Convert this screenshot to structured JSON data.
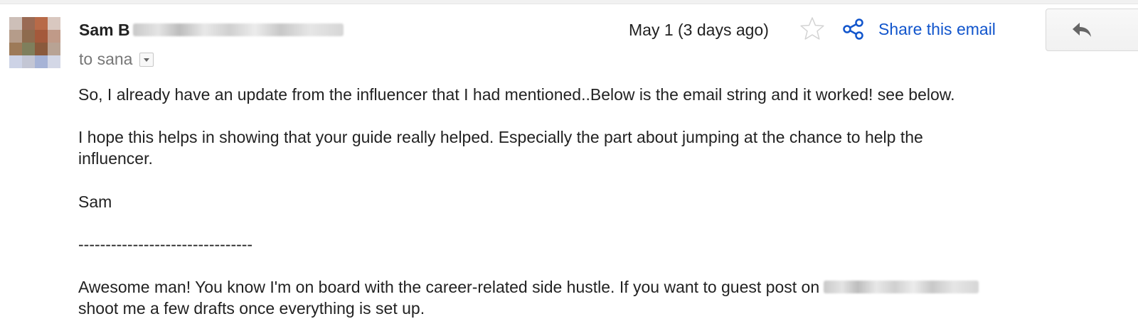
{
  "sender": {
    "name_visible": "Sam B",
    "recipient_line": "to sana"
  },
  "meta": {
    "date": "May 1 (3 days ago)"
  },
  "actions": {
    "share_label": "Share this email"
  },
  "icons": {
    "star": "star-outline-icon",
    "share": "share-icon",
    "reply": "reply-arrow-icon",
    "details": "chevron-down-icon"
  },
  "colors": {
    "link": "#1155cc",
    "text": "#222222",
    "muted": "#777777"
  },
  "body": {
    "p1": "So, I already have an update from the influencer that I had mentioned..Below is the email string and it worked! see below.",
    "p2_line1": "I hope this helps in showing that your guide really helped. Especially the part about jumping at the chance to help the",
    "p2_line2": "influencer.",
    "signoff": "Sam",
    "separator": "--------------------------------",
    "quoted_line1": "Awesome man! You know I'm on board with the career-related side hustle. If you want to guest post on",
    "quoted_line2": "shoot me a few drafts once everything is set up."
  }
}
